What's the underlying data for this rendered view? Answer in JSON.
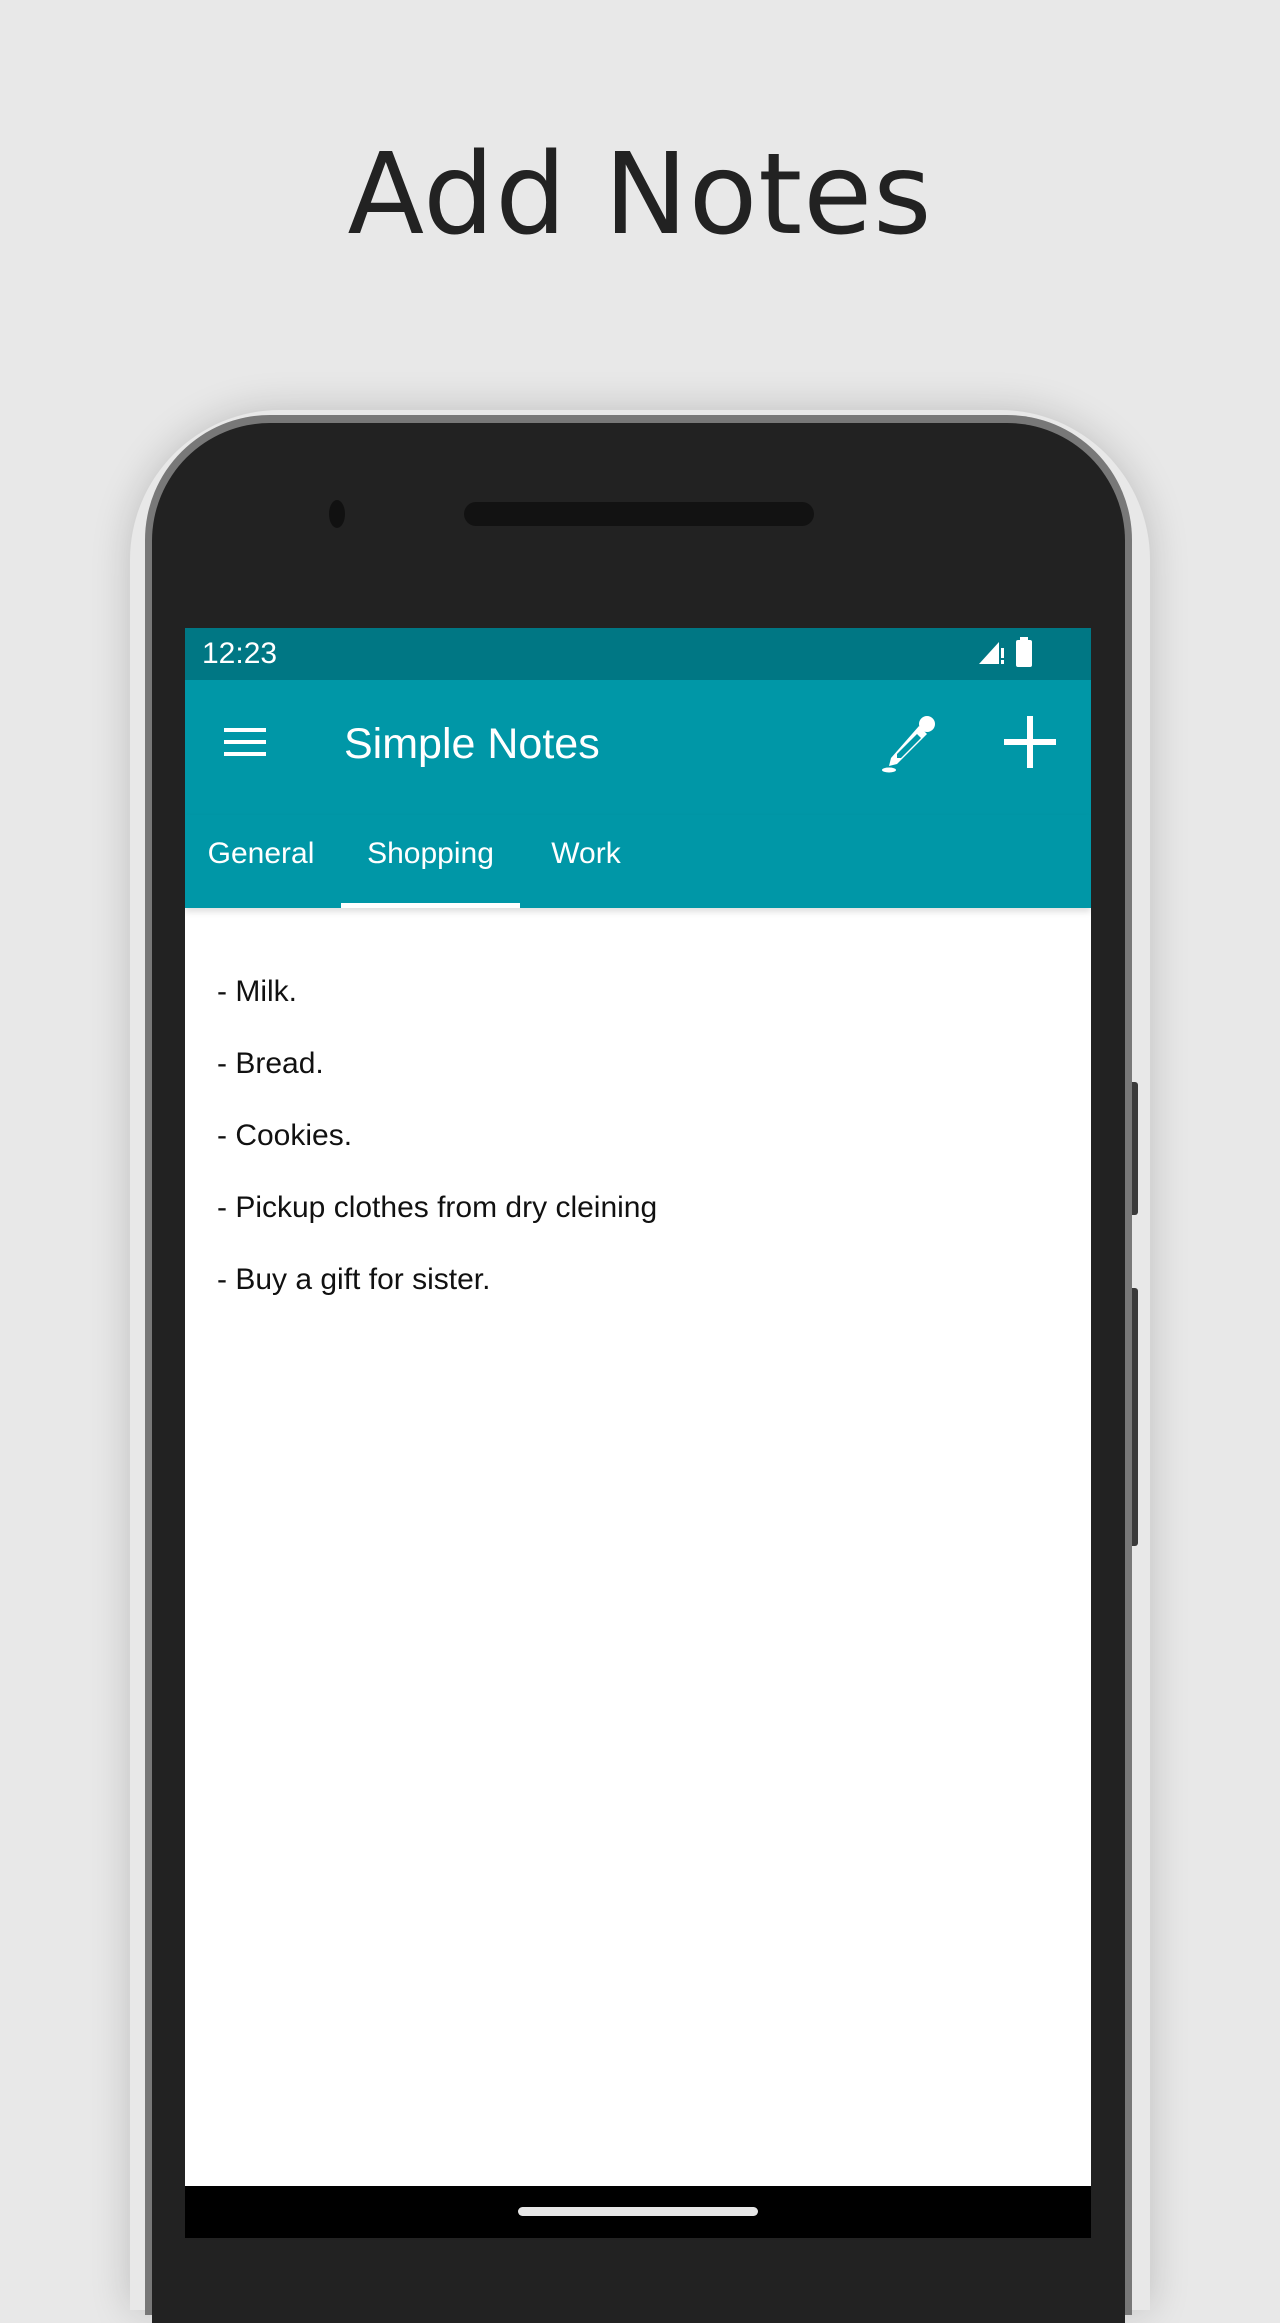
{
  "headline": "Add Notes",
  "status_bar": {
    "time": "12:23",
    "icons": [
      "signal-icon",
      "battery-icon"
    ]
  },
  "toolbar": {
    "title": "Simple Notes",
    "menu_icon": "hamburger-menu-icon",
    "actions": [
      {
        "name": "color-picker",
        "icon": "eyedropper-icon"
      },
      {
        "name": "add-note",
        "icon": "plus-icon"
      }
    ]
  },
  "tabs": [
    {
      "label": "General",
      "selected": false
    },
    {
      "label": "Shopping",
      "selected": true
    },
    {
      "label": "Work",
      "selected": false
    }
  ],
  "note": {
    "lines": [
      "- Milk.",
      "- Bread.",
      "- Cookies.",
      "- Pickup clothes from dry cleining",
      "- Buy a gift for sister."
    ]
  },
  "colors": {
    "status_bar": "#007784",
    "primary": "#0097a7",
    "background": "#e8e8e8",
    "phone_body": "#222222"
  }
}
